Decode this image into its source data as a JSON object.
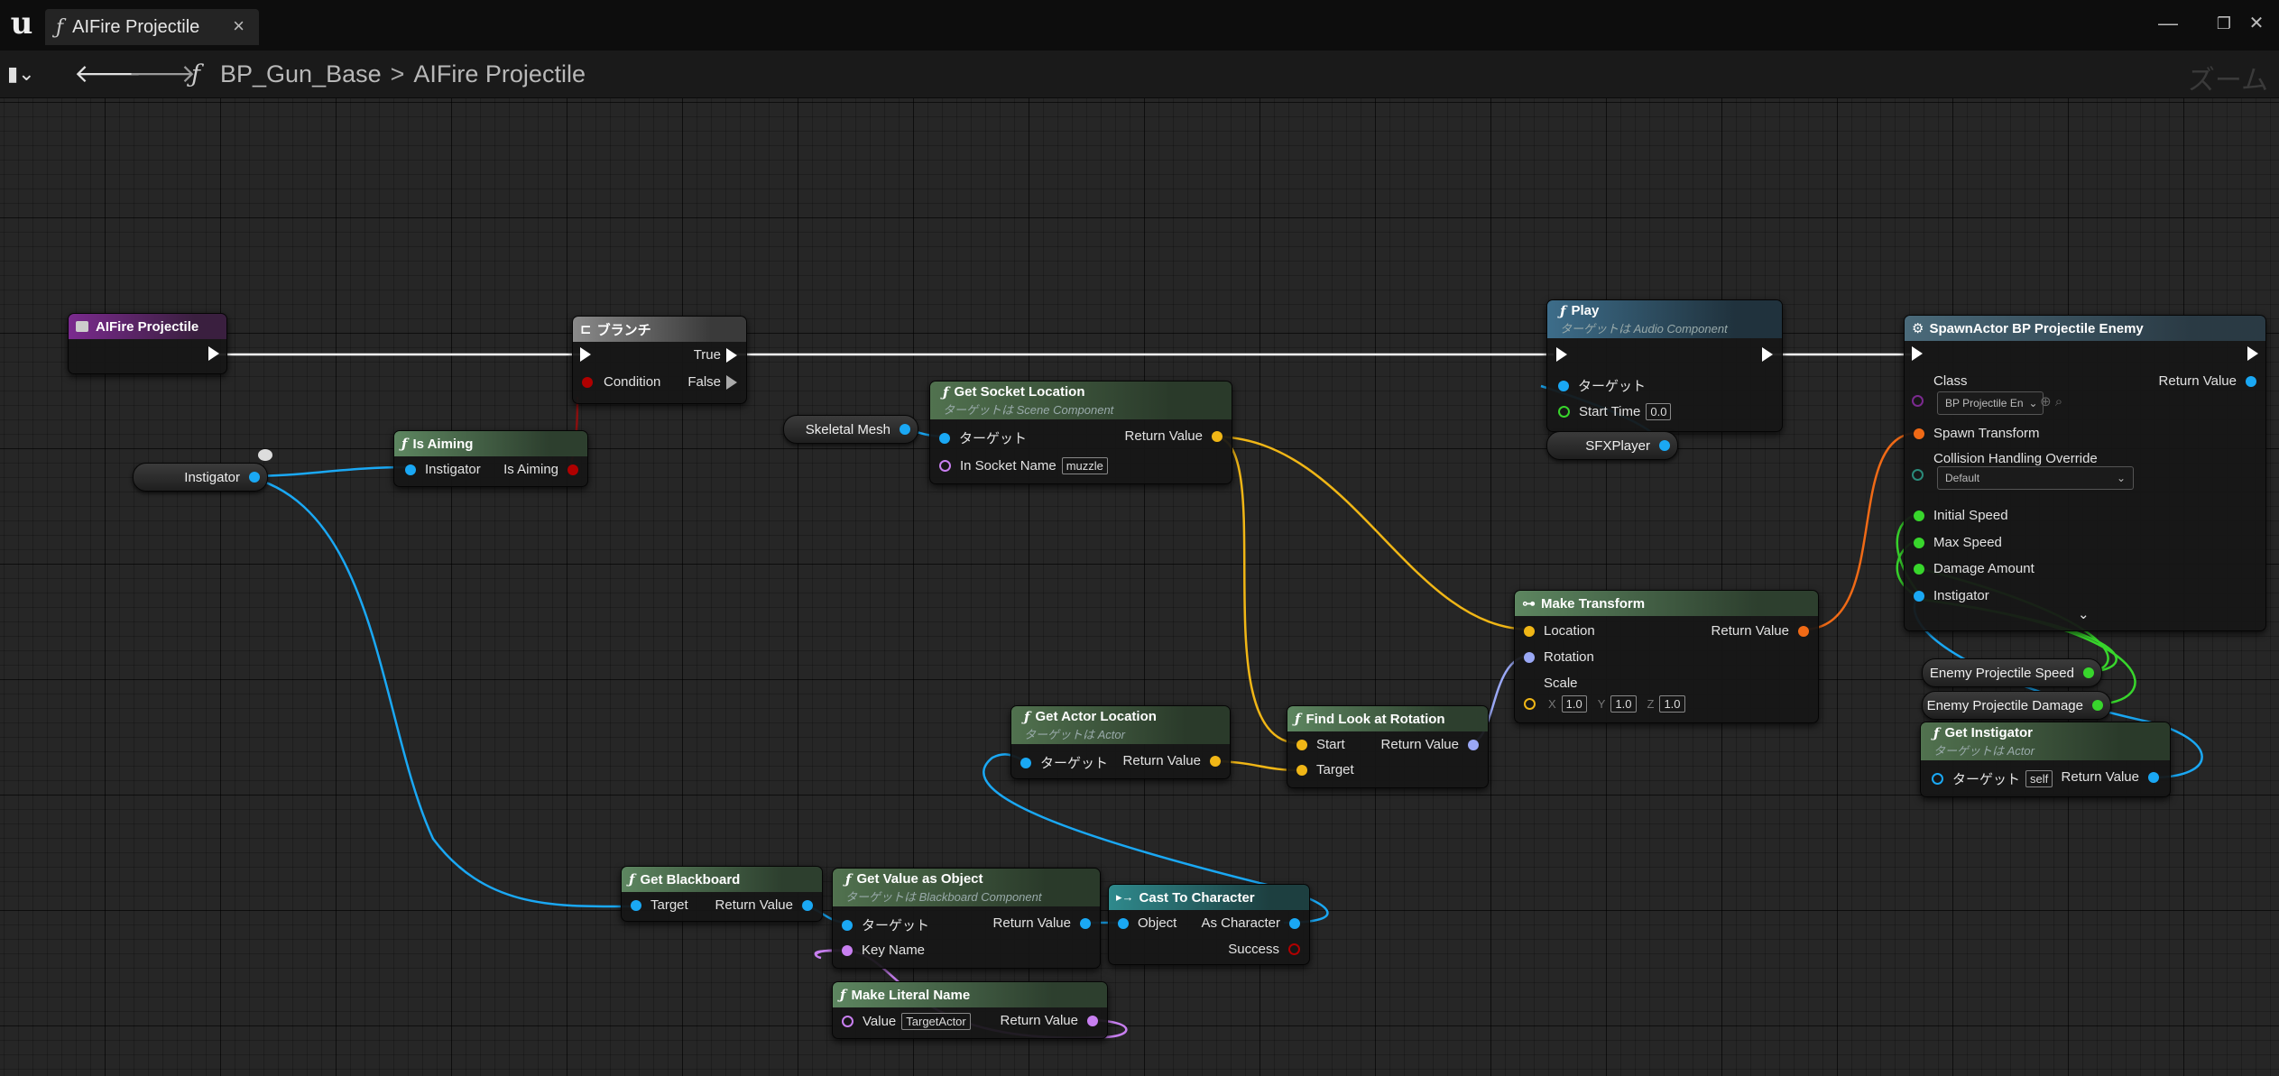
{
  "window": {
    "tab_icon": "function-icon",
    "tab_title": "AIFire Projectile",
    "tab_close": "×",
    "minimize": "—",
    "restore": "❐",
    "close": "✕"
  },
  "toolbar": {
    "bookmark": "▮⌄",
    "back": "🡐",
    "forward": "🡒",
    "crumb_root": "BP_Gun_Base",
    "crumb_sep": ">",
    "crumb_leaf": "AIFire Projectile",
    "zoom_label": "ズーム"
  },
  "nodes": {
    "entry": {
      "title": "AIFire Projectile"
    },
    "branch": {
      "title": "ブランチ",
      "true_label": "True",
      "false_label": "False",
      "condition_label": "Condition"
    },
    "is_aiming": {
      "title": "Is Aiming",
      "in_label": "Instigator",
      "out_label": "Is Aiming"
    },
    "instigator_var": {
      "label": "Instigator"
    },
    "skeletal_mesh_var": {
      "label": "Skeletal Mesh"
    },
    "get_socket": {
      "title": "Get Socket Location",
      "subtitle": "ターゲットは Scene Component",
      "target_label": "ターゲット",
      "socket_label": "In Socket Name",
      "socket_value": "muzzle",
      "return_label": "Return Value"
    },
    "play": {
      "title": "Play",
      "subtitle": "ターゲットは Audio Component",
      "target_label": "ターゲット",
      "start_label": "Start Time",
      "start_value": "0.0"
    },
    "sfx_var": {
      "label": "SFXPlayer"
    },
    "spawn": {
      "title": "SpawnActor BP Projectile Enemy",
      "class_label": "Class",
      "class_value": "BP Projectile En",
      "return_label": "Return Value",
      "transform_label": "Spawn Transform",
      "collision_label": "Collision Handling Override",
      "collision_value": "Default",
      "speed_label": "Initial Speed",
      "max_label": "Max Speed",
      "damage_label": "Damage Amount",
      "instigator_label": "Instigator",
      "expand": "⌄"
    },
    "make_transform": {
      "title": "Make Transform",
      "loc_label": "Location",
      "rot_label": "Rotation",
      "scale_label": "Scale",
      "x_label": "X",
      "x_value": "1.0",
      "y_label": "Y",
      "y_value": "1.0",
      "z_label": "Z",
      "z_value": "1.0",
      "return_label": "Return Value"
    },
    "enemy_speed_var": {
      "label": "Enemy Projectile Speed"
    },
    "enemy_damage_var": {
      "label": "Enemy Projectile Damage"
    },
    "get_instigator": {
      "title": "Get Instigator",
      "subtitle": "ターゲットは Actor",
      "target_label": "ターゲット",
      "target_value": "self",
      "return_label": "Return Value"
    },
    "get_actor_loc": {
      "title": "Get Actor Location",
      "subtitle": "ターゲットは Actor",
      "target_label": "ターゲット",
      "return_label": "Return Value"
    },
    "find_look": {
      "title": "Find Look at Rotation",
      "start_label": "Start",
      "target_label": "Target",
      "return_label": "Return Value"
    },
    "get_blackboard": {
      "title": "Get Blackboard",
      "target_label": "Target",
      "return_label": "Return Value"
    },
    "get_value": {
      "title": "Get Value as Object",
      "subtitle": "ターゲットは Blackboard Component",
      "target_label": "ターゲット",
      "key_label": "Key Name",
      "return_label": "Return Value"
    },
    "cast": {
      "title": "Cast To Character",
      "object_label": "Object",
      "as_label": "As Character",
      "success_label": "Success"
    },
    "make_literal": {
      "title": "Make Literal Name",
      "value_label": "Value",
      "value_text": "TargetActor",
      "return_label": "Return Value"
    }
  },
  "colors": {
    "exec": "#ffffff",
    "object": "#1aa8f4",
    "vector": "#f0b616",
    "rotator": "#9aa8f5",
    "transform": "#f06a16",
    "bool": "#b00000",
    "name": "#c87ff0",
    "float": "#38d62c"
  }
}
